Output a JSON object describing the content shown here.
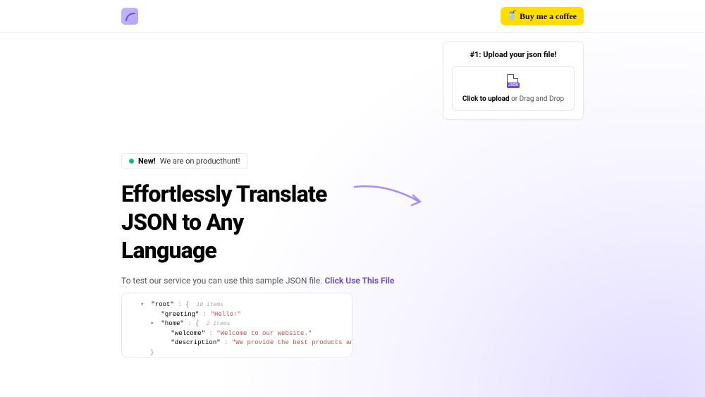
{
  "header": {
    "coffee_label": "Buy me a coffee"
  },
  "upload": {
    "title": "#1: Upload your json file!",
    "json_badge": "JSON",
    "click_text": "Click to upload",
    "drag_text": " or Drag and Drop"
  },
  "badge": {
    "new_label": "New!",
    "text": "We are on producthunt!"
  },
  "hero": {
    "title": "Effortlessly Translate JSON to Any Language",
    "subtitle_prefix": "To test our service you can use this sample JSON file. ",
    "link_text": "Click Use This File"
  },
  "json_sample": {
    "root_key": "\"root\"",
    "root_meta": "10 items",
    "greeting_key": "\"greeting\"",
    "greeting_val": "\"Hello!\"",
    "home_key": "\"home\"",
    "home_meta": "2 items",
    "welcome_key": "\"welcome\"",
    "welcome_val": "\"Welcome to our website.\"",
    "description_key": "\"description\"",
    "description_val": "\"We provide the best products and services.\""
  }
}
